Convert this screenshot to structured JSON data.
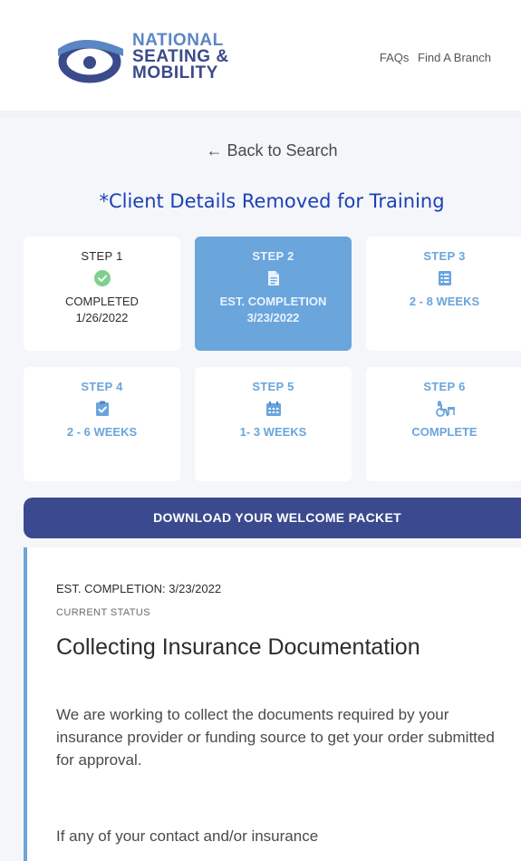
{
  "header": {
    "logo": {
      "line1": "NATIONAL",
      "line2": "SEATING &",
      "line3": "MOBILITY"
    },
    "nav": [
      {
        "label": "FAQs"
      },
      {
        "label": "Find A Branch"
      }
    ]
  },
  "back_link": "← Back to Search",
  "notice": "*Client Details Removed for Training",
  "steps": [
    {
      "step": "STEP 1",
      "status": "COMPLETED",
      "status2": "1/26/2022",
      "icon": "check-circle-icon",
      "state": "done"
    },
    {
      "step": "STEP 2",
      "status": "EST. COMPLETION",
      "status2": "3/23/2022",
      "icon": "document-icon",
      "state": "active"
    },
    {
      "step": "STEP 3",
      "status": "2 - 8 WEEKS",
      "status2": "",
      "icon": "list-icon",
      "state": "pending"
    },
    {
      "step": "STEP 4",
      "status": "2 - 6 WEEKS",
      "status2": "",
      "icon": "clipboard-check-icon",
      "state": "pending"
    },
    {
      "step": "STEP 5",
      "status": "1- 3 WEEKS",
      "status2": "",
      "icon": "calendar-icon",
      "state": "pending"
    },
    {
      "step": "STEP 6",
      "status": "COMPLETE",
      "status2": "",
      "icon": "wheelchair-icon",
      "state": "pending"
    }
  ],
  "download_button": "DOWNLOAD YOUR WELCOME PACKET",
  "status_panel": {
    "est_completion": "EST. COMPLETION: 3/23/2022",
    "current_status_label": "CURRENT STATUS",
    "title": "Collecting Insurance Documentation",
    "body": "We are working to collect the documents required by your insurance provider or funding source to get your order submitted for approval.",
    "body2": "If any of your contact and/or insurance"
  },
  "colors": {
    "accent": "#6aa5dc",
    "button": "#3b4a8e",
    "notice": "#1d40b8",
    "check": "#7fd08f"
  }
}
